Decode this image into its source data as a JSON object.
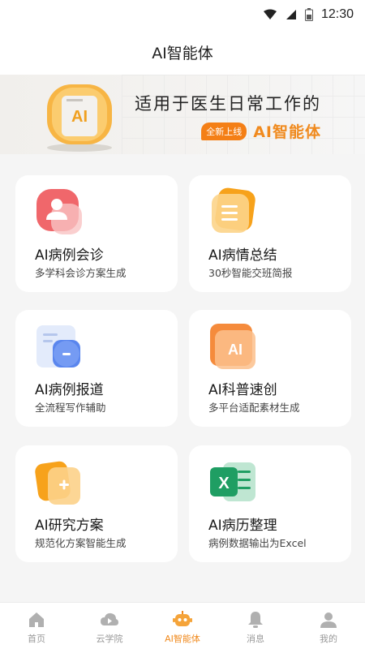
{
  "status_bar": {
    "time": "12:30"
  },
  "header": {
    "title": "AI智能体"
  },
  "banner": {
    "line1": "适用于医生日常工作的",
    "badge": "全新上线",
    "highlight": "AI智能体"
  },
  "cards": [
    {
      "title": "AI病例会诊",
      "subtitle": "多学科会诊方案生成",
      "icon": "consult-person-icon"
    },
    {
      "title": "AI病情总结",
      "subtitle": "30秒智能交班简报",
      "icon": "document-summary-icon"
    },
    {
      "title": "AI病例报道",
      "subtitle": "全流程写作辅助",
      "icon": "report-doc-icon"
    },
    {
      "title": "AI科普速创",
      "subtitle": "多平台适配素材生成",
      "icon": "ai-badge-icon",
      "icon_text": "AI"
    },
    {
      "title": "AI研究方案",
      "subtitle": "规范化方案智能生成",
      "icon": "research-plan-icon"
    },
    {
      "title": "AI病历整理",
      "subtitle": "病例数据输出为Excel",
      "icon": "excel-icon",
      "icon_text": "X"
    }
  ],
  "tabbar": {
    "active": 2,
    "items": [
      {
        "label": "首页",
        "icon": "home-icon"
      },
      {
        "label": "云学院",
        "icon": "cloud-play-icon"
      },
      {
        "label": "AI智能体",
        "icon": "robot-icon"
      },
      {
        "label": "消息",
        "icon": "bell-icon"
      },
      {
        "label": "我的",
        "icon": "user-icon"
      }
    ]
  },
  "colors": {
    "accent": "#f08a1e",
    "badge": "#f47f16",
    "consult": "#f0676b",
    "excel": "#1f9e63",
    "report": "#5a86ee"
  }
}
